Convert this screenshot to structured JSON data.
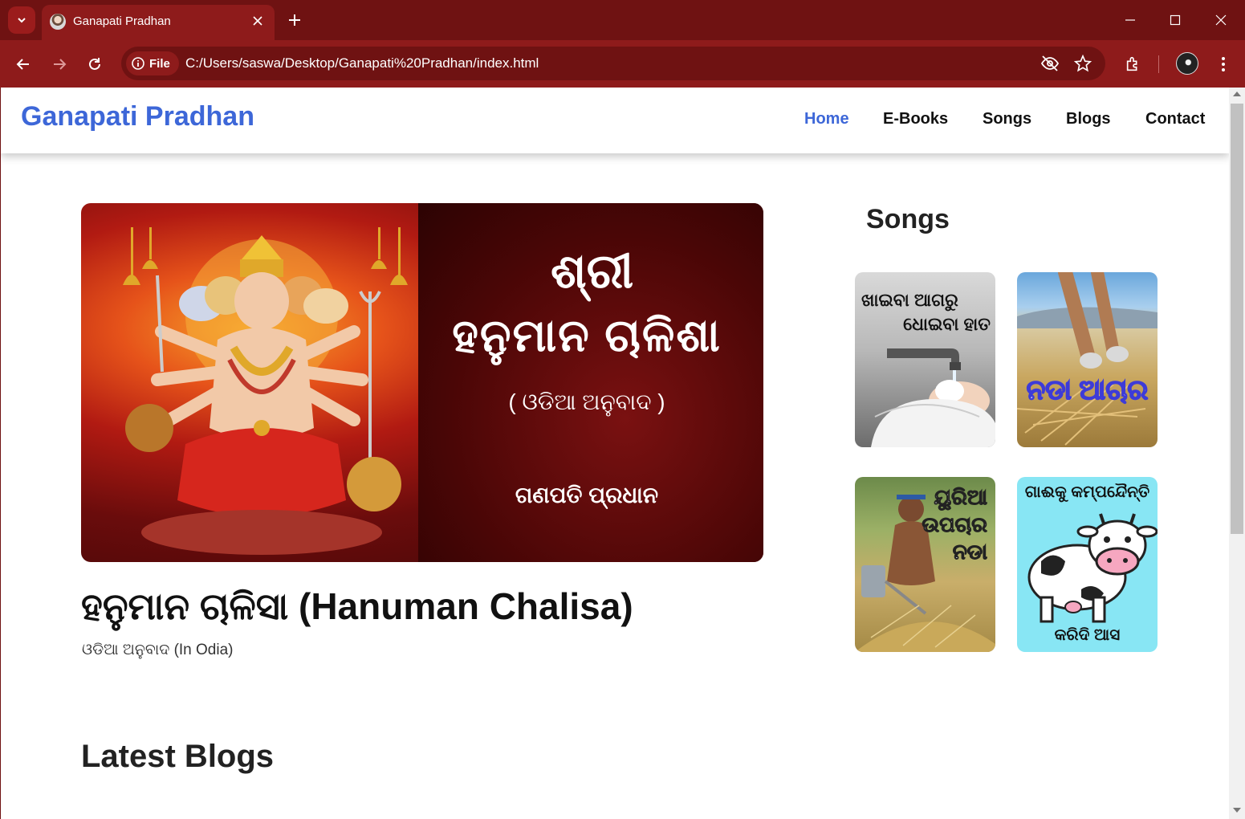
{
  "browser": {
    "tab_title": "Ganapati Pradhan",
    "chip_label": "File",
    "url": "C:/Users/saswa/Desktop/Ganapati%20Pradhan/index.html"
  },
  "site": {
    "brand": "Ganapati Pradhan",
    "nav": [
      {
        "label": "Home",
        "active": true
      },
      {
        "label": "E-Books",
        "active": false
      },
      {
        "label": "Songs",
        "active": false
      },
      {
        "label": "Blogs",
        "active": false
      },
      {
        "label": "Contact",
        "active": false
      }
    ]
  },
  "hero": {
    "line1": "ଶ୍ରୀ",
    "line2": "ହନୁମାନ ଚାଳିଶା",
    "line3": "( ଓଡିଆ ଅନୁବାଦ )",
    "line4": "ଗଣପତି ପ୍ରଧାନ"
  },
  "featured_post": {
    "title": "ହନୁମାନ ଚାଳିସା (Hanuman Chalisa)",
    "subtitle": "ଓଡିଆ ଅନୁବାଦ (In Odia)"
  },
  "sections": {
    "latest_blogs": "Latest Blogs",
    "songs": "Songs"
  },
  "songs": [
    {
      "caption_top": "ଖାଇବା ଆଗରୁ",
      "caption_bottom": "ଧୋଇବା ହାତ"
    },
    {
      "caption": "ନଡା ଆଚାର"
    },
    {
      "caption_lines": [
        "ୟୁରିଆ",
        "ଉପଚାର",
        "ନଡା"
      ]
    },
    {
      "caption_top": "ଗାଈକୁ କମ୍ପନ୍ଦୈନ୍ତି",
      "caption_bottom": "କରିଦି ଆସ"
    }
  ],
  "colors": {
    "brand_blue": "#3d67d8",
    "chrome_red": "#8e1b1b",
    "chrome_dark": "#6f1212"
  }
}
